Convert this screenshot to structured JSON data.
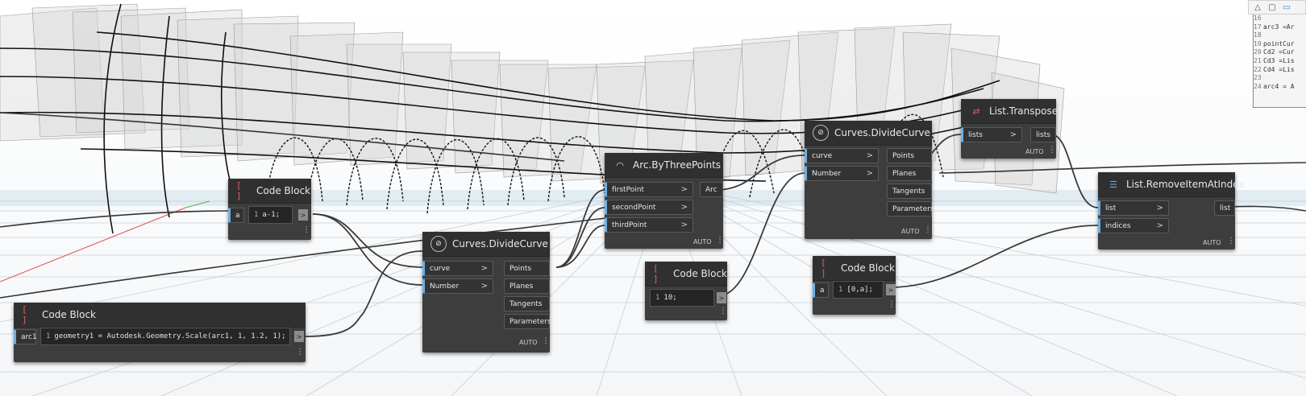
{
  "background": {
    "description_icon": "3d-geometry-background"
  },
  "toolbar": {
    "icons": [
      "geometry-view-icon",
      "cube-view-icon",
      "toggle-icon"
    ]
  },
  "code_editor": {
    "lines": [
      {
        "num": "16",
        "text": ""
      },
      {
        "num": "17",
        "text": "arc3 =Ar"
      },
      {
        "num": "18",
        "text": ""
      },
      {
        "num": "19",
        "text": "pointCur"
      },
      {
        "num": "20",
        "text": "Cd2 =Cur"
      },
      {
        "num": "21",
        "text": "Cd3 =Lis"
      },
      {
        "num": "22",
        "text": "Cd4 =Lis"
      },
      {
        "num": "23",
        "text": ""
      },
      {
        "num": "24",
        "text": "arc4 = A"
      }
    ]
  },
  "nodes": {
    "cb1": {
      "title": "Code Block",
      "input": "a",
      "line": "1",
      "code": "a-1;"
    },
    "cb_bottom": {
      "title": "Code Block",
      "input": "arc1",
      "line": "1",
      "code": "geometry1 = Autodesk.Geometry.Scale(arc1, 1, 1.2, 1);"
    },
    "divide1": {
      "title": "Curves.DivideCurve",
      "inputs": [
        "curve",
        "Number"
      ],
      "outputs": [
        "Points",
        "Planes",
        "Tangents",
        "Parameters"
      ],
      "auto": "AUTO"
    },
    "arc": {
      "title": "Arc.ByThreePoints",
      "inputs": [
        "firstPoint",
        "secondPoint",
        "thirdPoint"
      ],
      "outputs": [
        "Arc"
      ],
      "auto": "AUTO"
    },
    "cb_mid": {
      "title": "Code Block",
      "line": "1",
      "code": "10;"
    },
    "divide2": {
      "title": "Curves.DivideCurve",
      "inputs": [
        "curve",
        "Number"
      ],
      "outputs": [
        "Points",
        "Planes",
        "Tangents",
        "Parameters"
      ],
      "auto": "AUTO"
    },
    "cb_right": {
      "title": "Code Block",
      "input": "a",
      "line": "1",
      "code": "[0,a];"
    },
    "transpose": {
      "title": "List.Transpose",
      "inputs": [
        "lists"
      ],
      "outputs": [
        "lists"
      ],
      "auto": "AUTO"
    },
    "remove": {
      "title": "List.RemoveItemAtIndex",
      "inputs": [
        "list",
        "indices"
      ],
      "outputs": [
        "list"
      ],
      "auto": "AUTO"
    }
  },
  "port_arrow": ">",
  "colors": {
    "accent": "#6ab0e8",
    "node_bg": "#3d3d3d",
    "header_bg": "#303030"
  }
}
